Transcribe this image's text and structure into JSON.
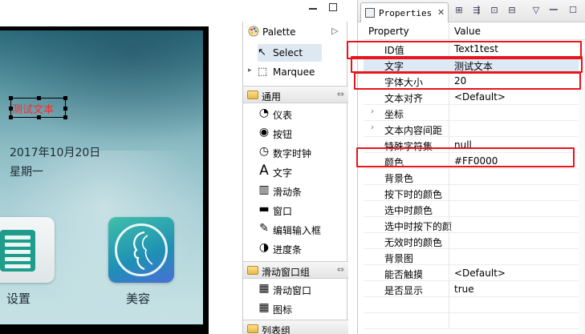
{
  "preview": {
    "selected_text": "测试文本",
    "date": "2017年10月20日",
    "weekday": "星期一",
    "apps": [
      {
        "label": "设置",
        "icon": "settings-grid-icon"
      },
      {
        "label": "美容",
        "icon": "beauty-face-icon"
      }
    ]
  },
  "palette": {
    "title": "Palette",
    "tools": [
      {
        "label": "Select",
        "icon": "arrow-cursor-icon",
        "selected": true
      },
      {
        "label": "Marquee",
        "icon": "marquee-icon",
        "selected": false
      }
    ],
    "groups": [
      {
        "label": "通用",
        "items": [
          {
            "label": "仪表",
            "icon": "gauge-icon"
          },
          {
            "label": "按钮",
            "icon": "button-icon"
          },
          {
            "label": "数字时钟",
            "icon": "clock-icon"
          },
          {
            "label": "文字",
            "icon": "text-icon"
          },
          {
            "label": "滑动条",
            "icon": "slider-icon"
          },
          {
            "label": "窗口",
            "icon": "window-icon"
          },
          {
            "label": "编辑输入框",
            "icon": "pencil-icon"
          },
          {
            "label": "进度条",
            "icon": "progress-icon"
          }
        ]
      },
      {
        "label": "滑动窗口组",
        "items": [
          {
            "label": "滑动窗口",
            "icon": "slide-window-icon"
          },
          {
            "label": "图标",
            "icon": "icon-grid-icon"
          }
        ]
      },
      {
        "label": "列表组",
        "items": []
      }
    ]
  },
  "properties": {
    "tab_label": "Properties",
    "columns": {
      "property": "Property",
      "value": "Value"
    },
    "rows": [
      {
        "name": "ID值",
        "value": "Text1test"
      },
      {
        "name": "文字",
        "value": "测试文本"
      },
      {
        "name": "字体大小",
        "value": "20"
      },
      {
        "name": "文本对齐",
        "value": "<Default>"
      },
      {
        "name": "坐标",
        "value": ""
      },
      {
        "name": "文本内容间距",
        "value": ""
      },
      {
        "name": "特殊字符集",
        "value": "null"
      },
      {
        "name": "颜色",
        "value": "#FF0000"
      },
      {
        "name": "背景色",
        "value": ""
      },
      {
        "name": "按下时的颜色",
        "value": ""
      },
      {
        "name": "选中时颜色",
        "value": ""
      },
      {
        "name": "选中时按下的颜",
        "value": ""
      },
      {
        "name": "无效时的颜色",
        "value": ""
      },
      {
        "name": "背景图",
        "value": ""
      },
      {
        "name": "能否触摸",
        "value": "<Default>"
      },
      {
        "name": "是否显示",
        "value": "true"
      }
    ]
  },
  "colors": {
    "highlight_box": "#e8151a",
    "selected_text_color": "#FF0000",
    "selection_row": "#dce9f7"
  }
}
